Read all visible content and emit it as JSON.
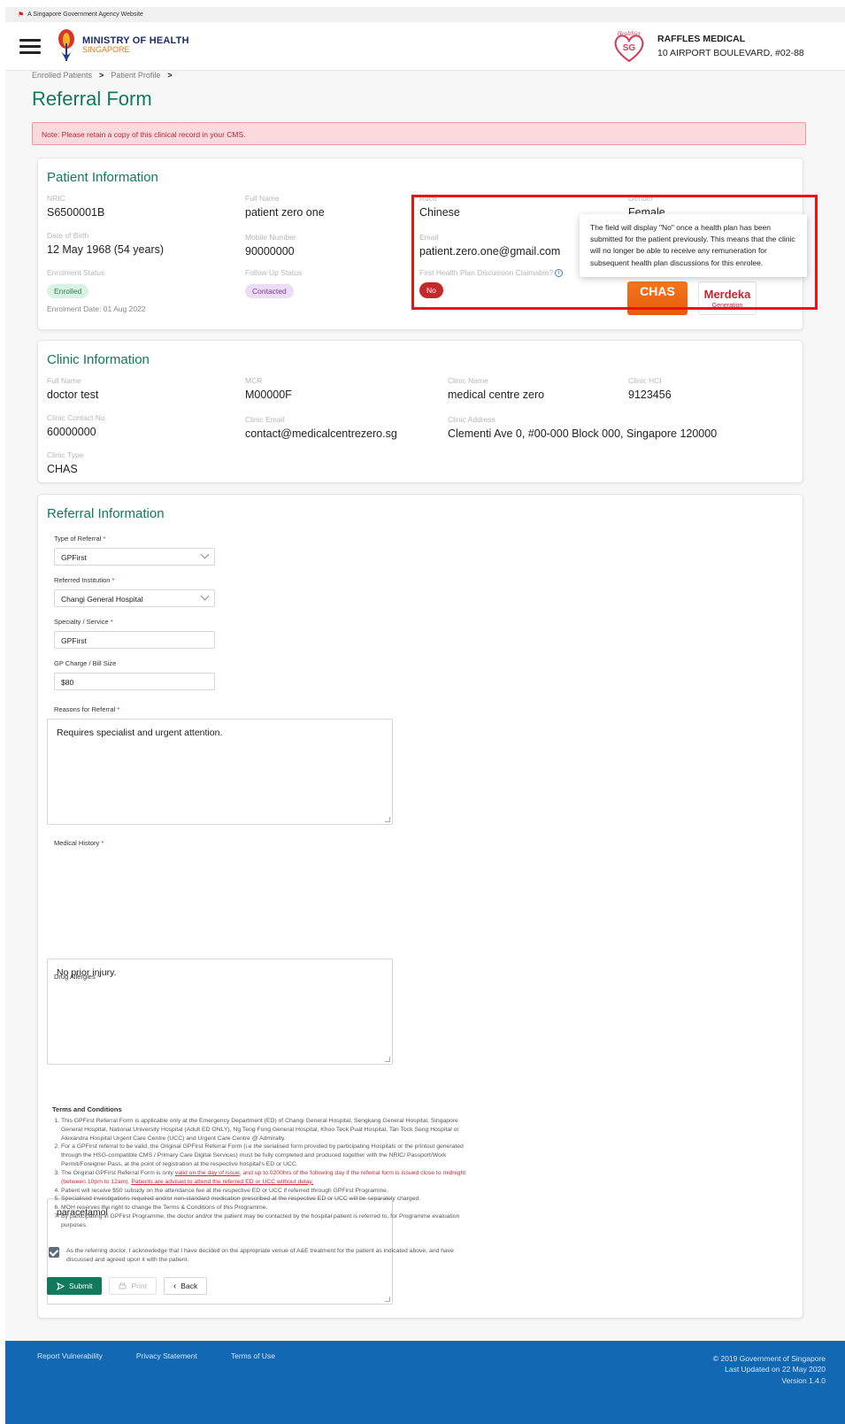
{
  "gov_strip": {
    "text": "A Singapore Government Agency Website"
  },
  "header": {
    "moh_line1": "MINISTRY OF HEALTH",
    "moh_line2": "SINGAPORE",
    "clinic_name": "RAFFLES MEDICAL",
    "clinic_address": "10 AIRPORT BOULEVARD, #02-88"
  },
  "breadcrumb": {
    "items": [
      "Enrolled Patients",
      "Patient Profile"
    ],
    "separator": ">"
  },
  "page_title": "Referral Form",
  "note": "Note: Please retain a copy of this clinical record in your CMS.",
  "patient": {
    "title": "Patient Information",
    "nric_label": "NRIC",
    "nric": "S6500001B",
    "fullname_label": "Full Name",
    "fullname": "patient zero one",
    "race_label": "Race",
    "race": "Chinese",
    "gender_label": "Gender",
    "gender": "Female",
    "dob_label": "Date of Birth",
    "dob": "12 May 1968 (54 years)",
    "mobile_label": "Mobile Number",
    "mobile": "90000000",
    "email_label": "Email",
    "email": "patient.zero.one@gmail.com",
    "enrolment_status_label": "Enrolment Status",
    "enrolment_status": "Enrolled",
    "followup_label": "Follow Up Status",
    "followup": "Contacted",
    "claimable_label": "First Health Plan Discussion Claimable?",
    "claimable": "No",
    "enrolment_date": "Enrolment Date: 01 Aug 2022",
    "chas_card": "CHAS",
    "merdeka_card_line1": "Merdeka",
    "merdeka_card_line2": "Generation",
    "tooltip": "The field will display \"No\" once a health plan has been submitted for the patient previously. This means that the clinic will no longer be able to receive any remuneration for subsequent health plan discussions for this enrolee."
  },
  "clinic": {
    "title": "Clinic Information",
    "fullname_label": "Full Name",
    "fullname": "doctor test",
    "mcr_label": "MCR",
    "mcr": "M00000F",
    "clinic_name_label": "Clinic Name",
    "clinic_name": "medical centre zero",
    "hci_label": "Clinic HCI",
    "hci": "9123456",
    "contact_label": "Clinic Contact No.",
    "contact": "60000000",
    "email_label": "Clinic Email",
    "email": "contact@medicalcentrezero.sg",
    "address_label": "Clinic Address",
    "address": "Clementi Ave 0, #00-000 Block 000, Singapore 120000",
    "type_label": "Clinic Type",
    "type": "CHAS"
  },
  "referral": {
    "title": "Referral Information",
    "type_label": "Type of Referral",
    "type": "GPFirst",
    "institution_label": "Referred Institution",
    "institution": "Changi General Hospital",
    "specialty_label": "Specialty / Service",
    "specialty": "GPFirst",
    "charge_label": "GP Charge / Bill Size",
    "charge": "$80",
    "reasons_label": "Reasons for Referral",
    "reasons": "Requires specialist and urgent attention.",
    "history_label": "Medical History",
    "history": "No prior injury.",
    "allergies_label": "Drug Allergies",
    "allergies": "paracetamol",
    "required_mark": "*"
  },
  "terms": {
    "title": "Terms and Conditions",
    "t1": "This GPFirst Referral Form is applicable only at the Emergency Department (ED) of Changi General Hospital, Sengkang General Hospital, Singapore General Hospital, National University Hospital (Adult ED ONLY), Ng Teng Fong General Hospital, Khoo Teck Puat Hospital, Tan Tock Seng Hospital or Alexandra Hospital Urgent Care Centre (UCC) and Urgent Care Centre @ Admiralty.",
    "t2": "For a GPFirst referral to be valid, the Original GPFirst Referral Form (i.e the serialised form provided by participating Hospitals or the printout generated through the HSG-compatible CMS / Primary Care Digital Services) must be fully completed and produced together with the NRIC/ Passport/Work Permit/Foreigner Pass, at the point of registration at the respective hospital's ED or UCC.",
    "t3a": "The Original GPFirst Referral Form is only",
    "t3b": "valid on the day of issue",
    "t3c": ", and up to 0200hrs of the following day if the referral form is issued close to midnight (between 10pm to 12am).",
    "t3d": "Patients are advised to attend the referred ED or UCC without delay.",
    "t4": "Patient will receive $50 subsidy on the attendance fee at the respective ED or UCC if referred through GPFirst Programme.",
    "t5": "Specialised investigations required and/or non-standard medication prescribed at the respective ED or UCC will be separately charged.",
    "t6": "MOH reserves the right to change the Terms & Conditions of this Programme.",
    "t7": "By participating in GPFirst Programme, the doctor and/or the patient may be contacted by the hospital patient is referred to, for Programme evaluation purposes.",
    "ack": "As the referring doctor, I acknowledge that I have decided on the appropriate venue of A&E treatment for the patient as indicated above, and have discussed and agreed upon it with the patient."
  },
  "buttons": {
    "submit": "Submit",
    "print": "Print",
    "back": "Back"
  },
  "footer": {
    "links": [
      "Report Vulnerability",
      "Privacy Statement",
      "Terms of Use"
    ],
    "copyright": "© 2019 Government of Singapore",
    "updated": "Last Updated on 22 May 2020",
    "version": "Version 1.4.0"
  },
  "colors": {
    "brand_green": "#117a5c",
    "footer_blue": "#1268b3",
    "alert_red": "#c52a2a",
    "highlight_box": "#ee1111"
  }
}
